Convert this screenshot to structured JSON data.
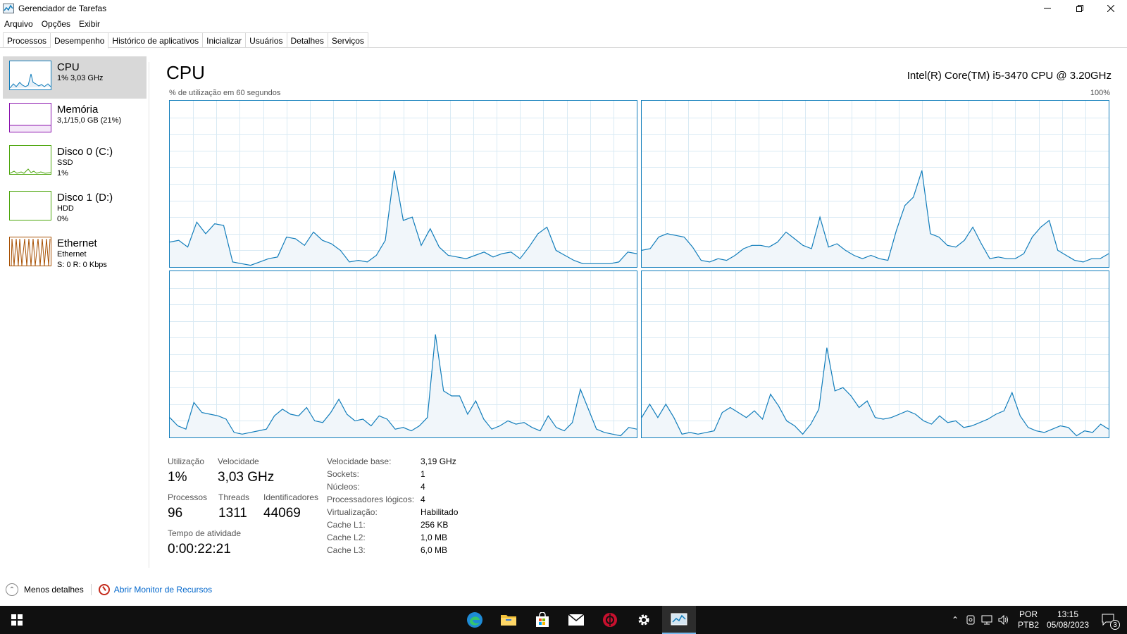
{
  "window": {
    "title": "Gerenciador de Tarefas"
  },
  "menu": [
    "Arquivo",
    "Opções",
    "Exibir"
  ],
  "tabs": [
    "Processos",
    "Desempenho",
    "Histórico de aplicativos",
    "Inicializar",
    "Usuários",
    "Detalhes",
    "Serviços"
  ],
  "sidebar": {
    "items": [
      {
        "title": "CPU",
        "line1": "1%  3,03 GHz",
        "line2": "",
        "color": "#117dbb"
      },
      {
        "title": "Memória",
        "line1": "3,1/15,0 GB (21%)",
        "line2": "",
        "color": "#8b12ae"
      },
      {
        "title": "Disco 0 (C:)",
        "line1": "SSD",
        "line2": "1%",
        "color": "#4da60c"
      },
      {
        "title": "Disco 1 (D:)",
        "line1": "HDD",
        "line2": "0%",
        "color": "#4da60c"
      },
      {
        "title": "Ethernet",
        "line1": "Ethernet",
        "line2": "S: 0  R: 0 Kbps",
        "color": "#a74f01"
      }
    ]
  },
  "main": {
    "title": "CPU",
    "cpu_name": "Intel(R) Core(TM) i5-3470 CPU @ 3.20GHz",
    "util_label": "% de utilização em 60 segundos",
    "max_label": "100%"
  },
  "stats": {
    "utilizacao_label": "Utilização",
    "utilizacao": "1%",
    "velocidade_label": "Velocidade",
    "velocidade": "3,03 GHz",
    "processos_label": "Processos",
    "processos": "96",
    "threads_label": "Threads",
    "threads": "1311",
    "identificadores_label": "Identificadores",
    "identificadores": "44069",
    "tempo_label": "Tempo de atividade",
    "tempo": "0:00:22:21"
  },
  "info": [
    {
      "label": "Velocidade base:",
      "value": "3,19 GHz"
    },
    {
      "label": "Sockets:",
      "value": "1"
    },
    {
      "label": "Núcleos:",
      "value": "4"
    },
    {
      "label": "Processadores lógicos:",
      "value": "4"
    },
    {
      "label": "Virtualização:",
      "value": "Habilitado"
    },
    {
      "label": "Cache L1:",
      "value": "256 KB"
    },
    {
      "label": "Cache L2:",
      "value": "1,0 MB"
    },
    {
      "label": "Cache L3:",
      "value": "6,0 MB"
    }
  ],
  "footer": {
    "less_details": "Menos detalhes",
    "open_resmon": "Abrir Monitor de Recursos"
  },
  "taskbar": {
    "lang_top": "POR",
    "lang_bottom": "PTB2",
    "time": "13:15",
    "date": "05/08/2023",
    "notifications": "3"
  },
  "colors": {
    "accent": "#117dbb",
    "grid": "#d9eaf4",
    "fill": "#f1f6fa"
  },
  "cores": [
    [
      15,
      16,
      12,
      27,
      20,
      26,
      25,
      3,
      2,
      1,
      3,
      5,
      6,
      18,
      17,
      13,
      21,
      16,
      14,
      10,
      3,
      4,
      3,
      7,
      16,
      58,
      28,
      30,
      13,
      23,
      12,
      7,
      6,
      5,
      7,
      9,
      6,
      8,
      9,
      5,
      12,
      20,
      24,
      10,
      7,
      4,
      2,
      2,
      2,
      2,
      3,
      9,
      8
    ],
    [
      10,
      11,
      18,
      20,
      19,
      18,
      12,
      4,
      3,
      5,
      4,
      7,
      11,
      13,
      13,
      12,
      15,
      21,
      17,
      13,
      11,
      30,
      12,
      14,
      10,
      7,
      5,
      7,
      5,
      4,
      22,
      37,
      42,
      58,
      20,
      18,
      13,
      12,
      16,
      24,
      14,
      5,
      6,
      5,
      5,
      8,
      18,
      24,
      28,
      10,
      7,
      4,
      3,
      5,
      5,
      8
    ],
    [
      12,
      7,
      5,
      21,
      15,
      14,
      13,
      11,
      3,
      2,
      3,
      4,
      5,
      13,
      17,
      14,
      13,
      18,
      10,
      9,
      15,
      23,
      14,
      10,
      11,
      7,
      13,
      11,
      5,
      6,
      4,
      7,
      12,
      62,
      28,
      25,
      25,
      14,
      22,
      11,
      5,
      7,
      10,
      8,
      9,
      6,
      4,
      13,
      6,
      4,
      9,
      29,
      17,
      5,
      3,
      2,
      1,
      6,
      5
    ],
    [
      12,
      20,
      12,
      20,
      12,
      2,
      3,
      2,
      3,
      4,
      15,
      18,
      15,
      12,
      16,
      11,
      26,
      19,
      10,
      7,
      2,
      8,
      17,
      54,
      28,
      30,
      25,
      18,
      22,
      12,
      11,
      12,
      14,
      16,
      14,
      10,
      8,
      13,
      9,
      10,
      6,
      7,
      9,
      11,
      14,
      16,
      27,
      13,
      6,
      4,
      3,
      5,
      7,
      6,
      1,
      4,
      3,
      8,
      5
    ]
  ]
}
